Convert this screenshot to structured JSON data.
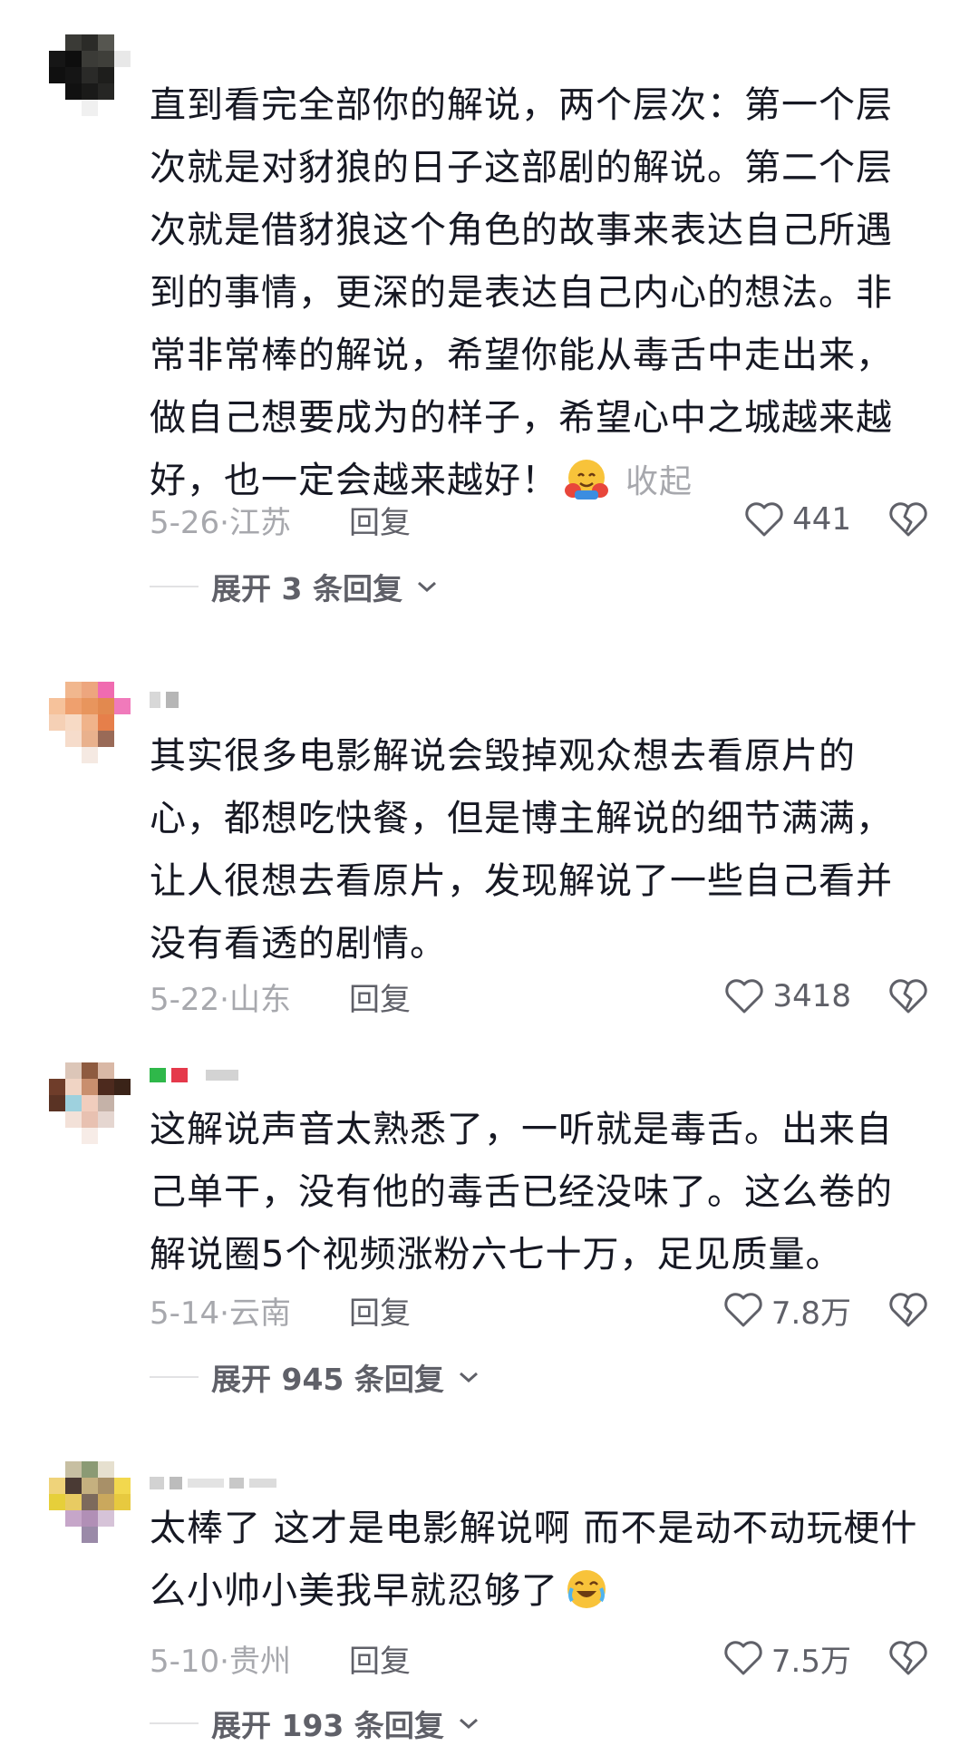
{
  "comments": [
    {
      "text": "直到看完全部你的解说，两个层次：第一个层次就是对豺狼的日子这部剧的解说。第二个层次就是借豺狼这个角色的故事来表达自己所遇到的事情，更深的是表达自己内心的想法。非常非常棒的解说，希望你能从毒舌中走出来，做自己想要成为的样子，希望心中之城越来越好，也一定会越来越好！",
      "collapse_label": "收起",
      "date": "5-26·江苏",
      "reply_label": "回复",
      "likes": "441",
      "expand_label": "展开 3 条回复"
    },
    {
      "text": "其实很多电影解说会毁掉观众想去看原片的心，都想吃快餐，但是博主解说的细节满满，让人很想去看原片，发现解说了一些自己看并没有看透的剧情。",
      "date": "5-22·山东",
      "reply_label": "回复",
      "likes": "3418"
    },
    {
      "text": "这解说声音太熟悉了，一听就是毒舌。出来自己单干，没有他的毒舌已经没味了。这么卷的解说圈5个视频涨粉六七十万，足见质量。",
      "date": "5-14·云南",
      "reply_label": "回复",
      "likes": "7.8万",
      "expand_label": "展开 945 条回复"
    },
    {
      "text": "太棒了 这才是电影解说啊 而不是动不动玩梗什么小帅小美我早就忍够了",
      "date": "5-10·贵州",
      "reply_label": "回复",
      "likes": "7.5万",
      "expand_label": "展开 193 条回复"
    }
  ],
  "colors": {
    "text": "#161823",
    "muted": "#a7a8ad",
    "secondary": "#5f6068"
  },
  "icons": [
    "heart-icon",
    "broken-heart-icon",
    "chevron-down-icon",
    "hug-emoji-icon",
    "crying-laughing-emoji-icon"
  ]
}
